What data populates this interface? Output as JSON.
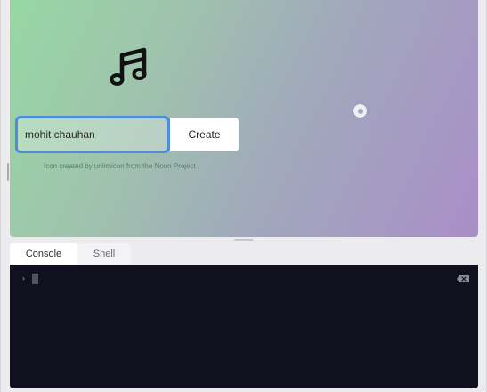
{
  "preview": {
    "name_input_value": "mohit chauhan",
    "create_button_label": "Create",
    "attribution_text": "Icon created by unlimicon from the Noun Project",
    "music_icon": "music-note-icon",
    "settings_icon": "settings-dot-icon"
  },
  "tabs": [
    {
      "label": "Console",
      "active": true
    },
    {
      "label": "Shell",
      "active": false
    }
  ],
  "console": {
    "prompt_symbol": "›",
    "clear_icon": "clear-console-icon"
  },
  "colors": {
    "gradient_start": "#97d7a3",
    "gradient_end": "#a98ec8",
    "input_border": "#4e8ed8",
    "console_bg": "#10111e",
    "prompt_color": "#e2c232"
  }
}
